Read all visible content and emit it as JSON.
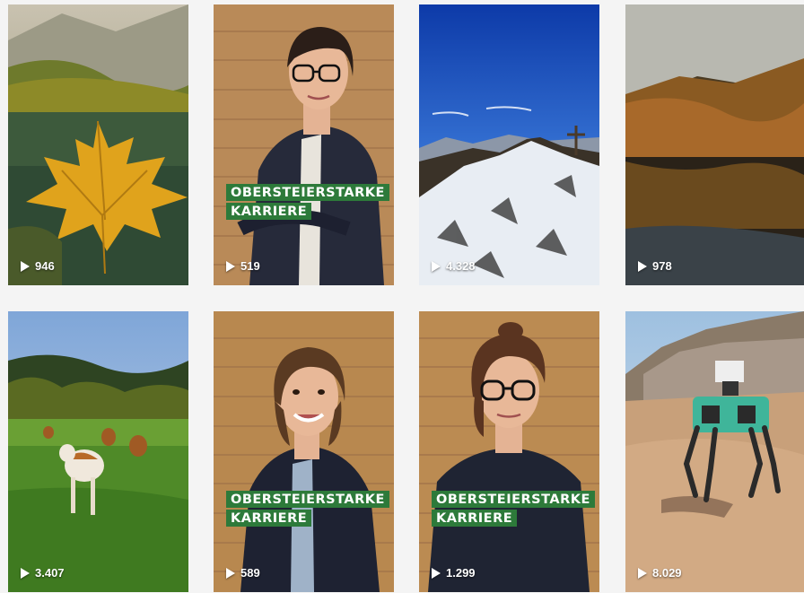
{
  "brand": {
    "line1": "OBERSTEIERSTARKE",
    "line2": "KARRIERE",
    "color": "#2d7a3a"
  },
  "tiles": [
    {
      "scene": "autumn-leaf-lake",
      "views": "946"
    },
    {
      "scene": "woman-portrait-glasses",
      "views": "519",
      "branded": true
    },
    {
      "scene": "mountain-summit-cross",
      "views": "4.328"
    },
    {
      "scene": "autumn-lake-reflection",
      "views": "978"
    },
    {
      "scene": "cows-in-meadow",
      "views": "3.407"
    },
    {
      "scene": "woman-portrait-smiling",
      "views": "589",
      "branded": true
    },
    {
      "scene": "woman-portrait-glasses-dark-top",
      "views": "1.299",
      "branded": true
    },
    {
      "scene": "robot-dog-quarry",
      "views": "8.029"
    }
  ]
}
